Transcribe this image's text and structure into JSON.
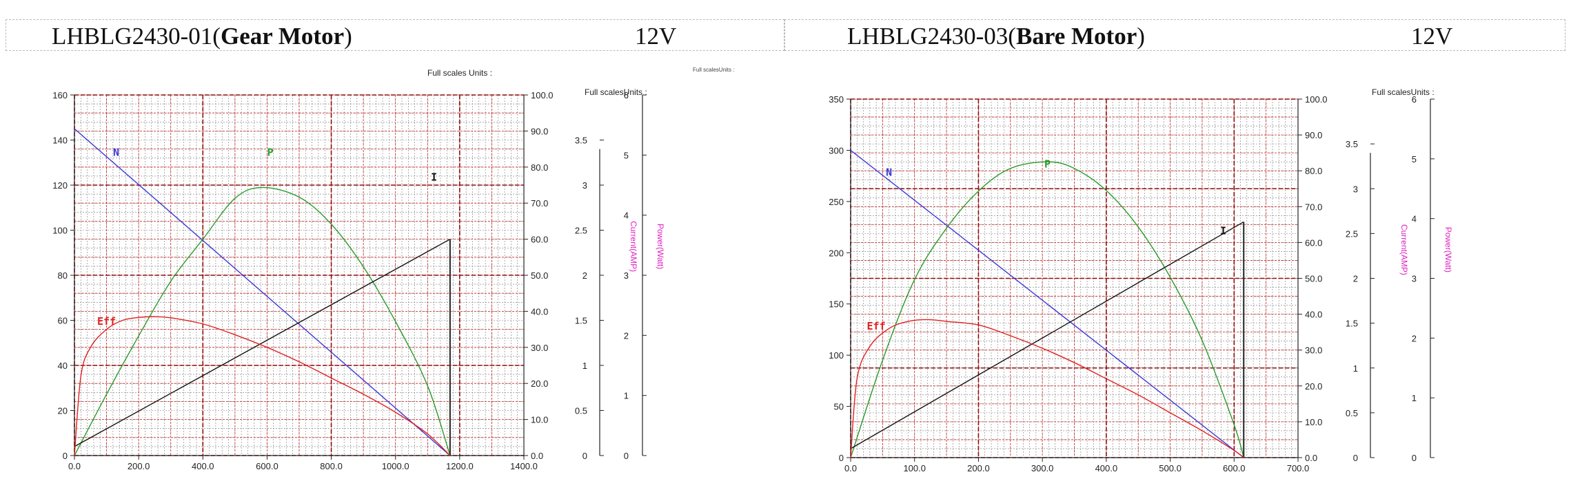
{
  "charts_header": [
    {
      "model": "LHBLG2430-01(",
      "model_bold": "Gear Motor",
      "model_close": ")",
      "voltage": "12V"
    },
    {
      "model": "LHBLG2430-03(",
      "model_bold": "Bare Motor",
      "model_close": ")",
      "voltage": "12V"
    }
  ],
  "chart_data": [
    {
      "type": "line",
      "title": "LHBLG2430-01(Gear Motor) 12V",
      "full_scale_label": "Full scales Units :",
      "full_scale_label_2": "Full scalesUnits :",
      "full_scale_label_3": "Full scalesUnits :",
      "x_ticks": [
        "0.0",
        "200.0",
        "400.0",
        "600.0",
        "800.0",
        "1000.0",
        "1200.0",
        "1400.0"
      ],
      "xlim": [
        0,
        1400
      ],
      "left_axis": {
        "ticks": [
          "0",
          "20",
          "40",
          "60",
          "80",
          "100",
          "120",
          "140",
          "160"
        ],
        "lim": [
          0,
          160
        ]
      },
      "eff_axis": {
        "ticks": [
          "0.0",
          "10.0",
          "20.0",
          "30.0",
          "40.0",
          "50.0",
          "60.0",
          "70.0",
          "80.0",
          "90.0",
          "100.0"
        ],
        "lim": [
          0,
          100
        ]
      },
      "current_axis": {
        "ticks": [
          "0",
          "0.5",
          "1",
          "1.5",
          "2",
          "2.5",
          "3",
          "3.5"
        ],
        "lim": [
          0,
          4
        ],
        "label": "Current(AMP)"
      },
      "power_axis": {
        "ticks": [
          "0",
          "1",
          "2",
          "3",
          "4",
          "5",
          "6"
        ],
        "lim": [
          0,
          6
        ],
        "label": "Power(Watt)"
      },
      "series": [
        {
          "name": "N",
          "color": "#3a3ad8",
          "x": [
            0,
            1170
          ],
          "y": [
            145,
            0
          ],
          "label_at": [
            130,
            133
          ]
        },
        {
          "name": "P",
          "color": "#2a9a2a",
          "x": [
            0,
            100,
            200,
            300,
            400,
            500,
            585,
            700,
            800,
            900,
            1000,
            1100,
            1170
          ],
          "y": [
            0,
            1.02,
            1.99,
            2.9,
            3.6,
            4.28,
            4.46,
            4.3,
            3.85,
            3.14,
            2.23,
            1.16,
            0
          ],
          "label_at": [
            610,
            133
          ],
          "y_axis": "power"
        },
        {
          "name": "I",
          "color": "#111111",
          "x": [
            0,
            1170
          ],
          "y": [
            0.1,
            2.4
          ],
          "label_at": [
            1120,
            122
          ],
          "y_axis": "current"
        },
        {
          "name": "Eff",
          "color": "#e02020",
          "x": [
            0,
            20,
            50,
            100,
            150,
            200,
            250,
            300,
            400,
            500,
            600,
            700,
            800,
            900,
            1000,
            1100,
            1170
          ],
          "y": [
            0,
            22,
            30,
            35,
            37.5,
            38.3,
            38.5,
            38.2,
            36.5,
            33.5,
            30,
            26,
            21.5,
            17,
            12,
            6,
            0
          ],
          "label_at": [
            100,
            58
          ],
          "y_axis": "eff"
        }
      ]
    },
    {
      "type": "line",
      "title": "LHBLG2430-03(Bare Motor) 12V",
      "full_scale_label": "Full scalesUnits :",
      "x_ticks": [
        "0.0",
        "100.0",
        "200.0",
        "300.0",
        "400.0",
        "500.0",
        "600.0",
        "700.0"
      ],
      "xlim": [
        0,
        700
      ],
      "left_axis": {
        "ticks": [
          "0",
          "50",
          "100",
          "150",
          "200",
          "250",
          "300",
          "350"
        ],
        "lim": [
          0,
          350
        ]
      },
      "eff_axis": {
        "ticks": [
          "0.0",
          "10.0",
          "20.0",
          "30.0",
          "40.0",
          "50.0",
          "60.0",
          "70.0",
          "80.0",
          "90.0",
          "100.0"
        ],
        "lim": [
          0,
          100
        ]
      },
      "current_axis": {
        "ticks": [
          "0",
          "0.5",
          "1",
          "1.5",
          "2",
          "2.5",
          "3",
          "3.5"
        ],
        "lim": [
          0,
          4
        ],
        "label": "Current(AMP)"
      },
      "power_axis": {
        "ticks": [
          "0",
          "1",
          "2",
          "3",
          "4",
          "5",
          "6"
        ],
        "lim": [
          0,
          6
        ],
        "label": "Power(Watt)"
      },
      "series": [
        {
          "name": "N",
          "color": "#3a3ad8",
          "x": [
            0,
            615
          ],
          "y": [
            300,
            0
          ],
          "label_at": [
            60,
            275
          ]
        },
        {
          "name": "P",
          "color": "#2a9a2a",
          "x": [
            0,
            50,
            100,
            150,
            200,
            250,
            308,
            350,
            400,
            450,
            500,
            550,
            600,
            615
          ],
          "y": [
            0,
            1.63,
            2.98,
            3.84,
            4.46,
            4.84,
            4.95,
            4.84,
            4.47,
            3.86,
            3.02,
            1.96,
            0.55,
            0
          ],
          "label_at": [
            308,
            283
          ],
          "y_axis": "power"
        },
        {
          "name": "I",
          "color": "#111111",
          "x": [
            0,
            615
          ],
          "y": [
            0.1,
            2.63
          ],
          "label_at": [
            583,
            218
          ],
          "y_axis": "current"
        },
        {
          "name": "Eff",
          "color": "#e02020",
          "x": [
            0,
            10,
            30,
            60,
            90,
            120,
            150,
            200,
            250,
            300,
            350,
            400,
            450,
            500,
            550,
            600,
            615
          ],
          "y": [
            0,
            22,
            31,
            36,
            38,
            38.5,
            38,
            37,
            34,
            30.5,
            26.5,
            22,
            17.5,
            12.5,
            7.5,
            2,
            0
          ],
          "label_at": [
            40,
            125
          ],
          "y_axis": "eff"
        }
      ]
    }
  ]
}
